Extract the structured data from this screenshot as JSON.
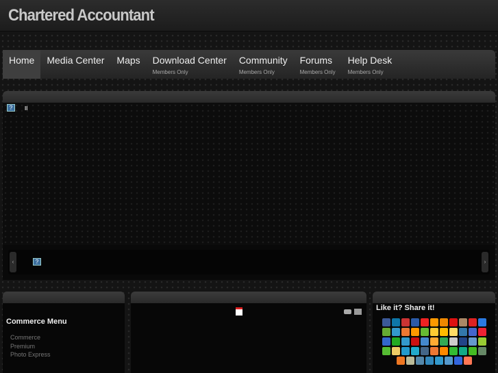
{
  "header": {
    "title": "Chartered Accountant"
  },
  "nav": [
    {
      "label": "Home",
      "sub": ""
    },
    {
      "label": "Media Center",
      "sub": ""
    },
    {
      "label": "Maps",
      "sub": ""
    },
    {
      "label": "Download Center",
      "sub": "Members Only"
    },
    {
      "label": "Community",
      "sub": "Members Only"
    },
    {
      "label": "Forums",
      "sub": "Members Only"
    },
    {
      "label": "Help Desk",
      "sub": "Members Only"
    }
  ],
  "slider": {
    "help": "?",
    "pause": "II",
    "prev": "‹",
    "next": "›"
  },
  "commerce": {
    "title": "Commerce Menu",
    "links": [
      "Commerce",
      "Premium",
      "Photo Express"
    ]
  },
  "share": {
    "title": "Like it? Share it!",
    "icon_colors": [
      "#3b5998",
      "#0e76a8",
      "#c33",
      "#2b5aa8",
      "#e22",
      "#f90",
      "#e80",
      "#d11",
      "#a86",
      "#d22",
      "#2a7ae2",
      "#6a3",
      "#39c",
      "#e73",
      "#f90",
      "#6b3",
      "#fc3",
      "#fb0",
      "#fd6",
      "#37a",
      "#46c",
      "#e23",
      "#36c",
      "#2a2",
      "#39c",
      "#c11",
      "#48c",
      "#fa3",
      "#3a5",
      "#ccc",
      "#248",
      "#69c",
      "#9c3",
      "#5b3",
      "#ec6",
      "#29c",
      "#2ac",
      "#468",
      "#e73",
      "#f80",
      "#3b3",
      "#1a8",
      "#4b2",
      "#686",
      "#e72",
      "#bb9",
      "#58a",
      "#38b",
      "#39c",
      "#59c",
      "#36d",
      "#f75"
    ]
  }
}
